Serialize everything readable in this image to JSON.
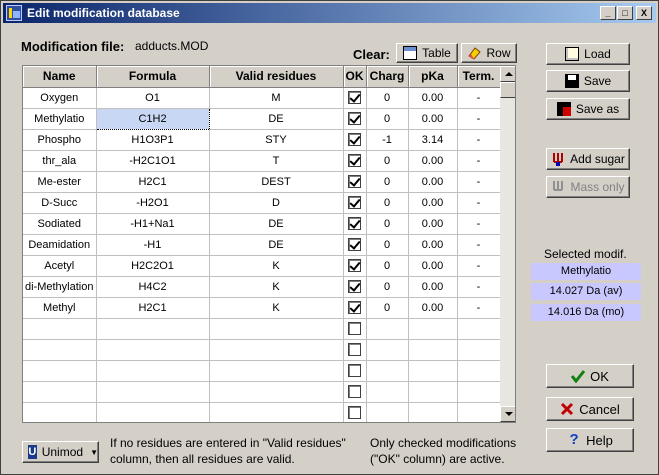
{
  "window": {
    "title": "Edit modification database"
  },
  "title_buttons": {
    "minimize": "_",
    "maximize": "□",
    "close": "X"
  },
  "file": {
    "label": "Modification file:",
    "value": "adducts.MOD"
  },
  "clear": {
    "label": "Clear:",
    "table_button": "Table",
    "row_button": "Row"
  },
  "table": {
    "columns": [
      "Name",
      "Formula",
      "Valid residues",
      "OK",
      "Charg",
      "pKa",
      "Term."
    ],
    "rows": [
      {
        "name": "Oxygen",
        "formula": "O1",
        "residues": "M",
        "ok": true,
        "charge": "0",
        "pka": "0.00",
        "term": "-"
      },
      {
        "name": "Methylatio",
        "formula": "C1H2",
        "residues": "DE",
        "ok": true,
        "charge": "0",
        "pka": "0.00",
        "term": "-"
      },
      {
        "name": "Phospho",
        "formula": "H1O3P1",
        "residues": "STY",
        "ok": true,
        "charge": "-1",
        "pka": "3.14",
        "term": "-"
      },
      {
        "name": "thr_ala",
        "formula": "-H2C1O1",
        "residues": "T",
        "ok": true,
        "charge": "0",
        "pka": "0.00",
        "term": "-"
      },
      {
        "name": "Me-ester",
        "formula": "H2C1",
        "residues": "DEST",
        "ok": true,
        "charge": "0",
        "pka": "0.00",
        "term": "-"
      },
      {
        "name": "D-Succ",
        "formula": "-H2O1",
        "residues": "D",
        "ok": true,
        "charge": "0",
        "pka": "0.00",
        "term": "-"
      },
      {
        "name": "Sodiated",
        "formula": "-H1+Na1",
        "residues": "DE",
        "ok": true,
        "charge": "0",
        "pka": "0.00",
        "term": "-"
      },
      {
        "name": "Deamidation",
        "formula": "-H1",
        "residues": "DE",
        "ok": true,
        "charge": "0",
        "pka": "0.00",
        "term": "-"
      },
      {
        "name": "Acetyl",
        "formula": "H2C2O1",
        "residues": "K",
        "ok": true,
        "charge": "0",
        "pka": "0.00",
        "term": "-"
      },
      {
        "name": "di-Methylation",
        "formula": "H4C2",
        "residues": "K",
        "ok": true,
        "charge": "0",
        "pka": "0.00",
        "term": "-"
      },
      {
        "name": "Methyl",
        "formula": "H2C1",
        "residues": "K",
        "ok": true,
        "charge": "0",
        "pka": "0.00",
        "term": "-"
      },
      {
        "name": "",
        "formula": "",
        "residues": "",
        "ok": false,
        "charge": "",
        "pka": "",
        "term": ""
      },
      {
        "name": "",
        "formula": "",
        "residues": "",
        "ok": false,
        "charge": "",
        "pka": "",
        "term": ""
      },
      {
        "name": "",
        "formula": "",
        "residues": "",
        "ok": false,
        "charge": "",
        "pka": "",
        "term": ""
      },
      {
        "name": "",
        "formula": "",
        "residues": "",
        "ok": false,
        "charge": "",
        "pka": "",
        "term": ""
      },
      {
        "name": "",
        "formula": "",
        "residues": "",
        "ok": false,
        "charge": "",
        "pka": "",
        "term": ""
      }
    ]
  },
  "side_buttons": {
    "load": "Load",
    "save": "Save",
    "save_as": "Save as",
    "add_sugar": "Add sugar",
    "mass_only": "Mass only"
  },
  "selected": {
    "label": "Selected modif.",
    "name": "Methylatio",
    "mass_av": "14.027 Da (av)",
    "mass_mo": "14.016 Da (mo)"
  },
  "actions": {
    "ok": "OK",
    "cancel": "Cancel",
    "help": "Help"
  },
  "footer": {
    "unimod": "Unimod",
    "note_left": "If no residues are entered in \"Valid residues\" column, then all residues are valid.",
    "note_right": "Only checked modifications (\"OK\" column) are active."
  }
}
